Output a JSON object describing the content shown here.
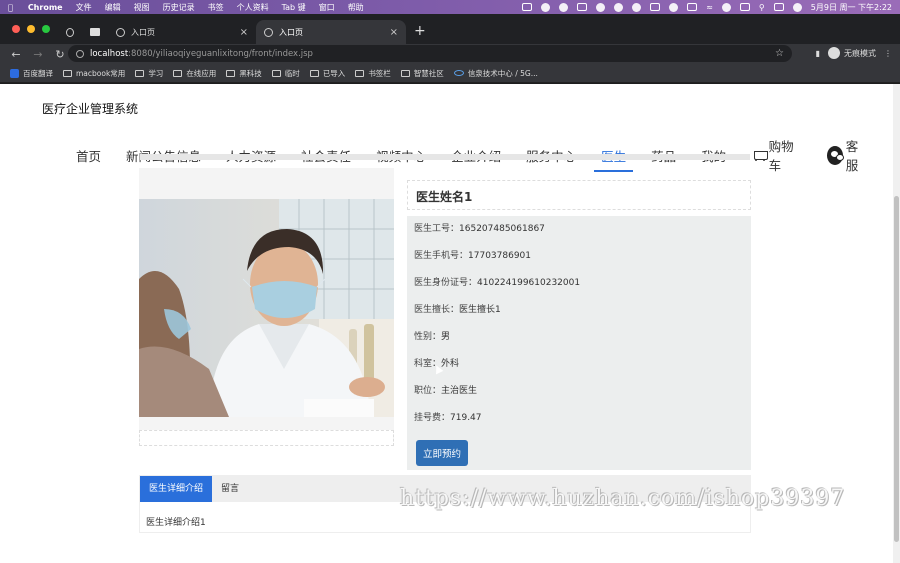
{
  "menubar": {
    "apple": "",
    "app": "Chrome",
    "items": [
      "文件",
      "编辑",
      "视图",
      "历史记录",
      "书签",
      "个人资料",
      "Tab 键",
      "窗口",
      "帮助"
    ],
    "clock": "5月9日 周一 下午2:22"
  },
  "browser": {
    "tabs": [
      {
        "title": ""
      },
      {
        "title": "入口页"
      },
      {
        "title": "入口页"
      }
    ],
    "url_host": "localhost",
    "url_path": ":8080/yiliaoqiyeguanlixitong/front/index.jsp",
    "incognito_label": "无痕模式",
    "bookmarks": [
      "百度翻译",
      "macbook常用",
      "学习",
      "在线应用",
      "黑科技",
      "临时",
      "已导入",
      "书签栏",
      "智慧社区",
      "信泉技术中心 / 5G..."
    ]
  },
  "site": {
    "title": "医疗企业管理系统",
    "nav": [
      "首页",
      "新闻公告信息",
      "人力资源",
      "社会责任",
      "视频中心",
      "企业介绍",
      "服务中心",
      "医生",
      "药品",
      "我的"
    ],
    "cart_label": "购物车",
    "service_label": "客服"
  },
  "doctor": {
    "name": "医生姓名1",
    "fields": [
      {
        "label": "医生工号：",
        "value": "165207485061867"
      },
      {
        "label": "医生手机号：",
        "value": "17703786901"
      },
      {
        "label": "医生身份证号：",
        "value": "410224199610232001"
      },
      {
        "label": "医生擅长：",
        "value": "医生擅长1"
      },
      {
        "label": "性别：",
        "value": "男"
      },
      {
        "label": "科室：",
        "value": "外科"
      },
      {
        "label": "职位：",
        "value": "主治医生"
      },
      {
        "label": "挂号费：",
        "value": "719.47"
      }
    ],
    "book_label": "立即预约"
  },
  "tabs": {
    "detail_label": "医生详细介绍",
    "message_label": "留言",
    "content": "医生详细介绍1"
  },
  "watermark": "https://www.huzhan.com/ishop39397",
  "colors": {
    "accent": "#2a6fdb",
    "button": "#2f6fb5"
  }
}
